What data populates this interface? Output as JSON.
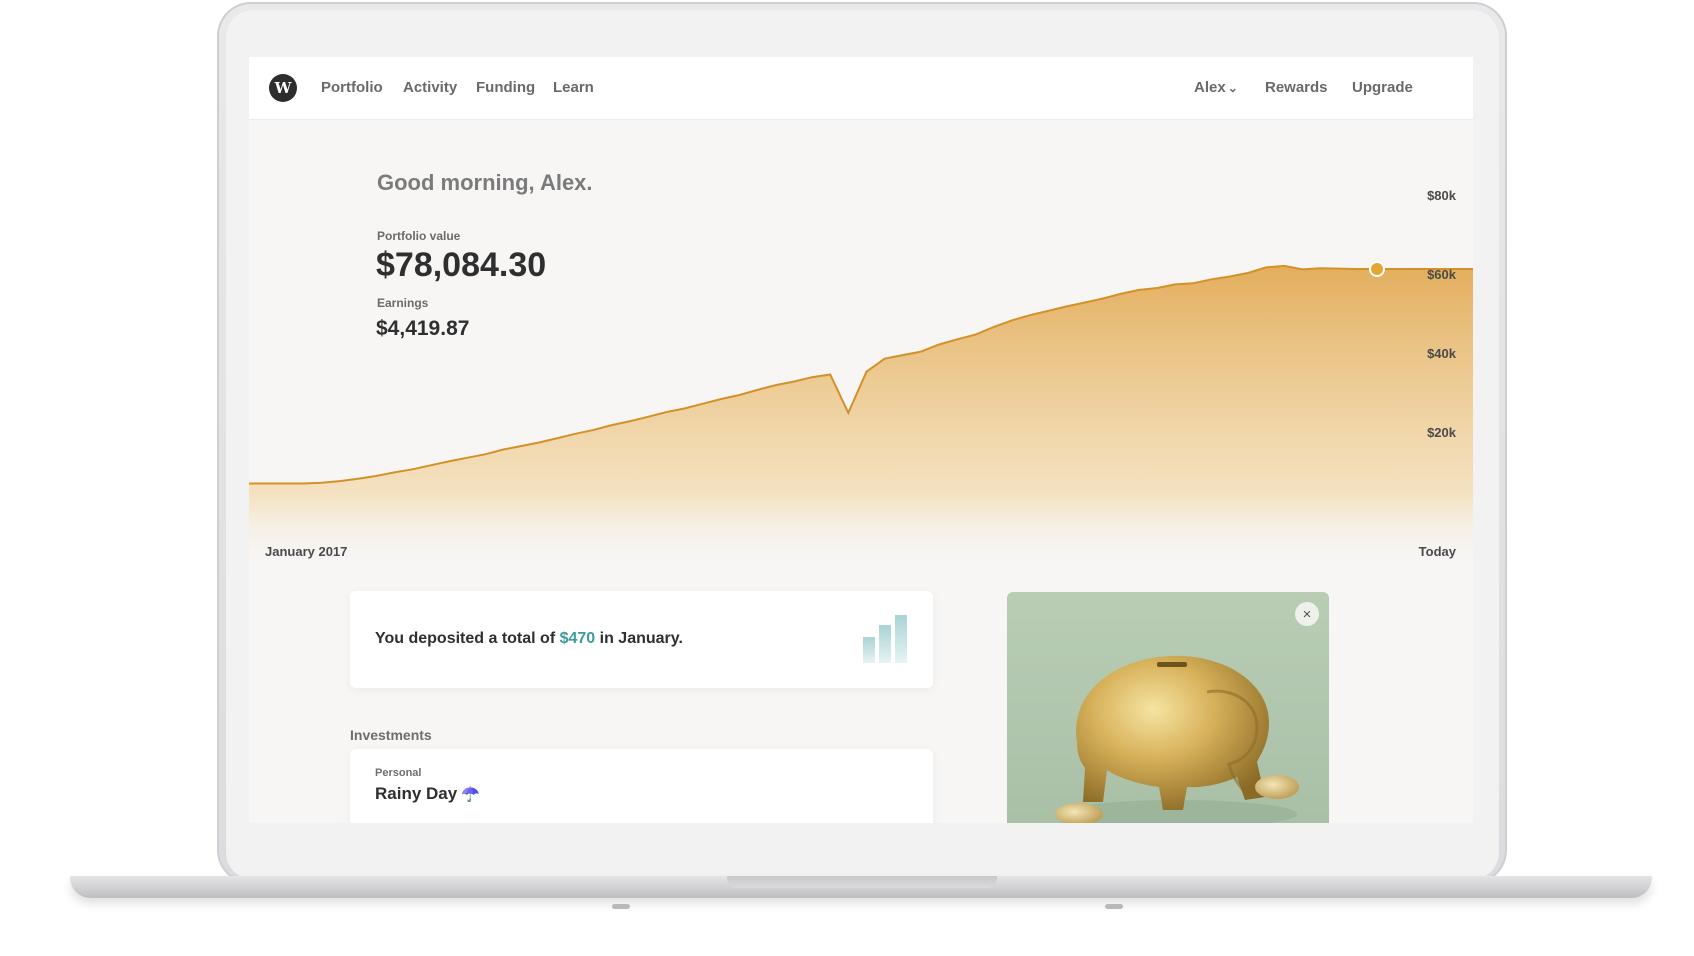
{
  "nav": {
    "logo_letter": "W",
    "links": [
      "Portfolio",
      "Activity",
      "Funding",
      "Learn"
    ],
    "user": "Alex",
    "user_chevron": "⌄",
    "rewards": "Rewards",
    "upgrade": "Upgrade"
  },
  "hero": {
    "greeting": "Good morning, Alex.",
    "portfolio_label": "Portfolio value",
    "portfolio_value": "$78,084.30",
    "earnings_label": "Earnings",
    "earnings_value": "$4,419.87"
  },
  "chart_data": {
    "type": "area",
    "x_start_label": "January 2017",
    "x_end_label": "Today",
    "y_ticks": [
      "$80k",
      "$60k",
      "$40k",
      "$20k"
    ],
    "ylim": [
      0,
      80000
    ],
    "color": "#e0a850",
    "values": [
      10000,
      10000,
      10000,
      10000,
      10200,
      10600,
      11200,
      11900,
      12800,
      13600,
      14600,
      15600,
      16500,
      17400,
      18600,
      19500,
      20400,
      21500,
      22600,
      23600,
      24800,
      25800,
      26900,
      28100,
      29000,
      30200,
      31400,
      32400,
      33700,
      34900,
      35800,
      36900,
      37600,
      27900,
      38300,
      41600,
      42500,
      43400,
      45200,
      46500,
      47700,
      49600,
      51300,
      52600,
      53700,
      54800,
      55800,
      56800,
      58000,
      59000,
      59500,
      60400,
      60700,
      61700,
      62400,
      63300,
      64700,
      65100,
      64200,
      64500,
      64400,
      64300,
      64300
    ],
    "grid": false,
    "current_marker": true
  },
  "deposit": {
    "prefix": "You deposited a total of ",
    "amount": "$470",
    "suffix": " in January."
  },
  "investments": {
    "section_title": "Investments",
    "account_type": "Personal",
    "account_name": "Rainy Day",
    "account_emoji": "☂️"
  },
  "promo": {
    "close_icon": "×"
  },
  "colors": {
    "accent": "#3f9aa0",
    "chart_fill": "#e0a850"
  }
}
